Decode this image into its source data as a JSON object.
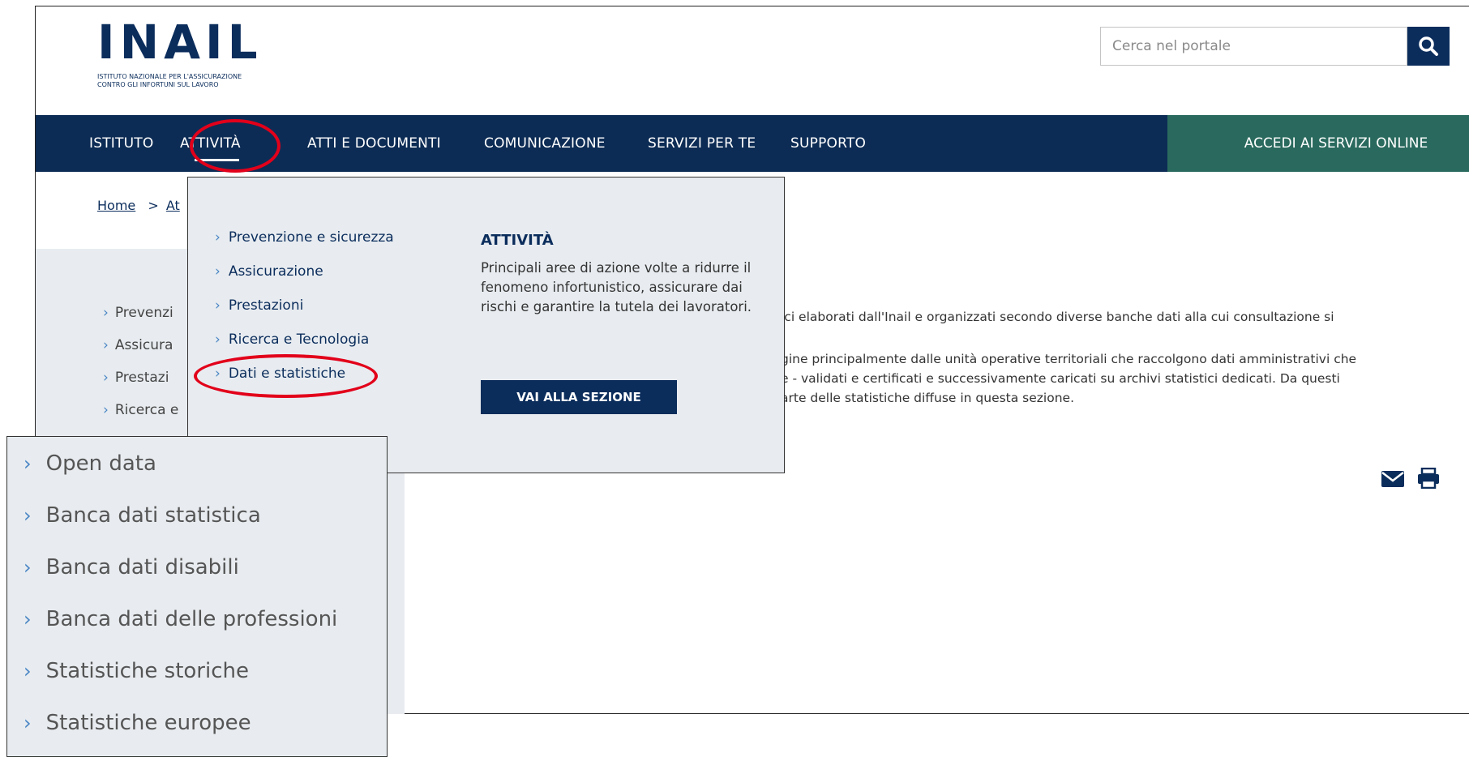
{
  "header": {
    "logo_text": "INAIL",
    "logo_subtitle_line1": "ISTITUTO NAZIONALE PER L'ASSICURAZIONE",
    "logo_subtitle_line2": "CONTRO GLI INFORTUNI SUL LAVORO",
    "search_placeholder": "Cerca nel portale",
    "search_icon": "search-icon"
  },
  "nav": {
    "items": [
      {
        "label": "ISTITUTO"
      },
      {
        "label": "ATTIVITÀ"
      },
      {
        "label": "ATTI E DOCUMENTI"
      },
      {
        "label": "COMUNICAZIONE"
      },
      {
        "label": "SERVIZI PER TE"
      },
      {
        "label": "SUPPORTO"
      }
    ],
    "online_label": "ACCEDI AI SERVIZI ONLINE",
    "bg_color": "#0d2c55",
    "online_color": "#2a6a5e"
  },
  "breadcrumb": {
    "home": "Home",
    "separator": ">",
    "current": "At"
  },
  "sidebar": {
    "items": [
      {
        "label": "Prevenzi"
      },
      {
        "label": "Assicura"
      },
      {
        "label": "Prestazi"
      },
      {
        "label": "Ricerca e"
      }
    ]
  },
  "content": {
    "line1": "ici elaborati dall'Inail e organizzati secondo diverse banche dati alla cui consultazione si",
    "line2": "gine principalmente dalle unità operative territoriali che raccolgono dati amministrativi che",
    "line3": "e - validati e certificati e successivamente caricati su archivi statistici dedicati. Da questi",
    "line4": "arte delle statistiche diffuse in questa sezione."
  },
  "dropdown": {
    "items": [
      {
        "label": "Prevenzione e sicurezza"
      },
      {
        "label": "Assicurazione"
      },
      {
        "label": "Prestazioni"
      },
      {
        "label": "Ricerca e Tecnologia"
      },
      {
        "label": "Dati e statistiche"
      }
    ],
    "title": "ATTIVITÀ",
    "description": "Principali aree di azione volte a ridurre il fenomeno infortunistico, assicurare dai rischi e garantire la tutela dei lavoratori.",
    "button_label": "VAI ALLA SEZIONE"
  },
  "inset": {
    "items": [
      {
        "label": "Open data"
      },
      {
        "label": "Banca dati statistica"
      },
      {
        "label": "Banca dati disabili"
      },
      {
        "label": "Banca dati delle professioni"
      },
      {
        "label": "Statistiche storiche"
      },
      {
        "label": "Statistiche europee"
      }
    ]
  },
  "colors": {
    "accent": "#0b2d5c",
    "chevron": "#4a86c5",
    "highlight": "#e2001a",
    "panel": "#e8ecf0"
  }
}
